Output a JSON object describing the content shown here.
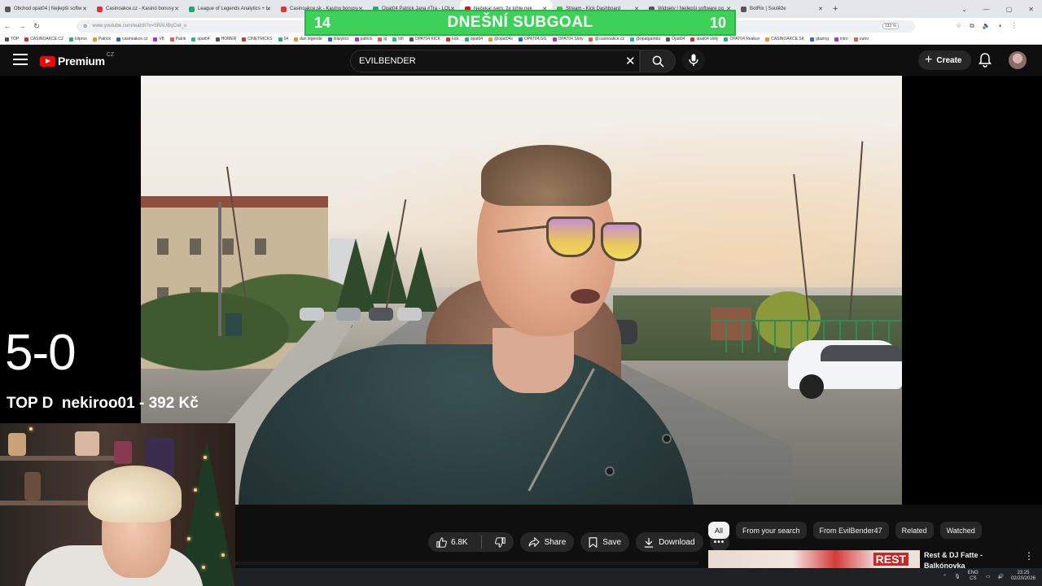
{
  "browser": {
    "tabs": [
      {
        "label": "Obchod opat04 | Nejlepší softw"
      },
      {
        "label": "Casinoakce.cz - Kasinó bonusy"
      },
      {
        "label": "League of Legends Analytics + L"
      },
      {
        "label": "Casinoakce.sk - Kasíno bonusy"
      },
      {
        "label": "Opat04 Patrick Jana #Tra - LOL"
      },
      {
        "label": "Nečekal jsem, že tohle nek"
      },
      {
        "label": "Stream - Kick Dashboard"
      },
      {
        "label": "Widgety | Nejlepší software po"
      },
      {
        "label": "BotRix | Soutěže"
      }
    ],
    "url": "www.youtube.com/watch?v=5RAUBqCwl_o",
    "zoom": "133 %",
    "bookmarks": [
      "TOP",
      "CASINOAKCE.CZ",
      "lolpros",
      "Patrick",
      "casinoakce.cz",
      "V8",
      "Patrik",
      "opat04",
      "HOMER",
      "CINETRICKS",
      "04",
      "dan legende",
      "lolalytics",
      "patrick",
      "ig",
      "lofi",
      "OPAT04 KICK",
      "kick",
      "opat04",
      "@opat04s",
      "OPAT04.GG",
      "OPAT04 Sloty",
      "@casinoakce.cz",
      "@opatgamba",
      "Opat04",
      "opat04 sloty",
      "OPAT04 Reakce",
      "CASINOAKCE.SK",
      "glazing",
      "intro",
      "outro"
    ]
  },
  "subgoal": {
    "left": "14",
    "title": "DNEŠNÍ SUBGOAL",
    "right": "10"
  },
  "youtube": {
    "wordmark": "Premium",
    "country": "CZ",
    "search_value": "EVILBENDER",
    "create_label": "Create"
  },
  "overlay": {
    "score": "5-0",
    "top_donor": "TOP D  nekiroo01 - 392 Kč"
  },
  "actions": {
    "like_count": "6.8K",
    "share_label": "Share",
    "save_label": "Save",
    "download_label": "Download"
  },
  "chips": [
    "All",
    "From your search",
    "From EvilBender47",
    "Related",
    "Watched"
  ],
  "recommendation": {
    "title": "Rest & DJ Fatte - Balkónovka",
    "thumb_badge": "REST"
  },
  "taskbar": {
    "lang_top": "ENG",
    "lang_bottom": "CS",
    "time": "23:25",
    "date": "02/20/2026"
  }
}
